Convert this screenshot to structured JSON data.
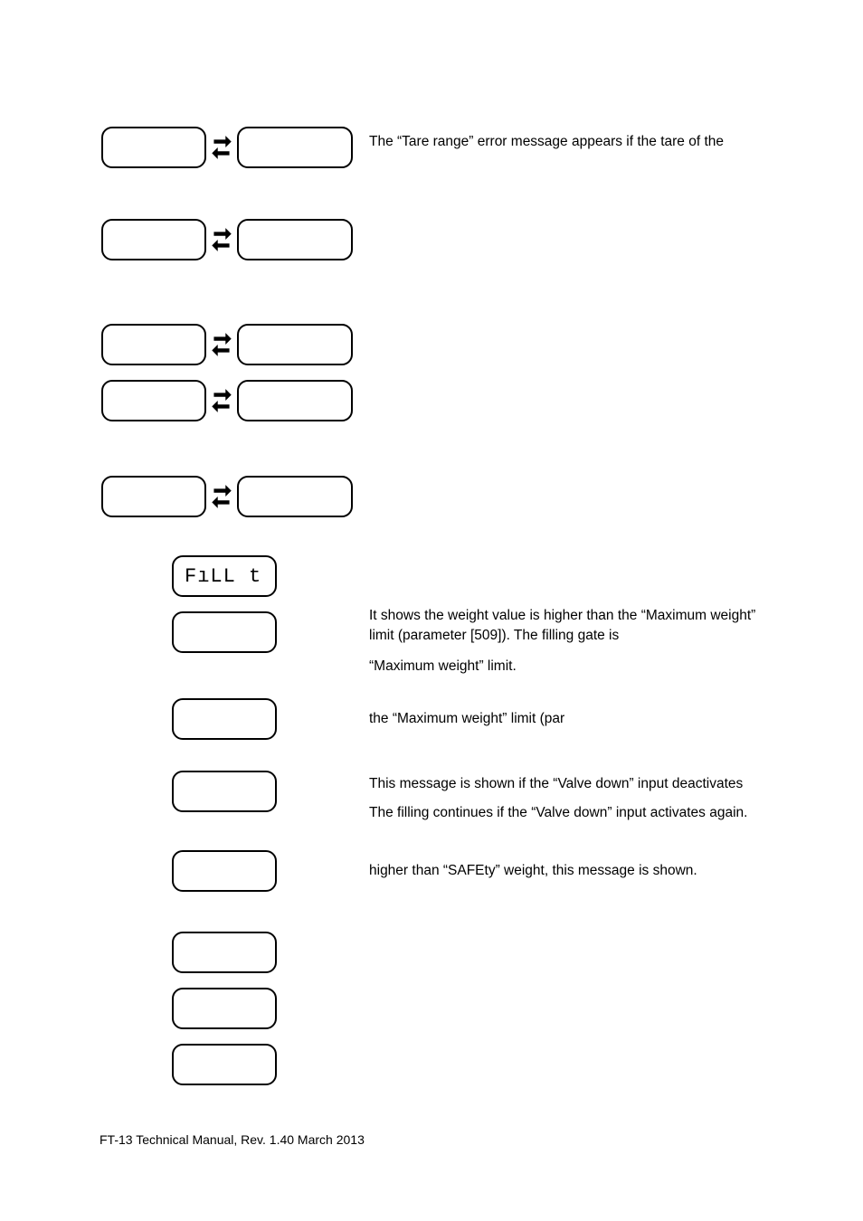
{
  "rows": {
    "r1": {
      "left": "",
      "right": "",
      "text": "The “Tare range” error message appears if the tare of the"
    },
    "r2": {
      "left": "",
      "right": "",
      "text": ""
    },
    "r3": {
      "left": "",
      "right": "",
      "text": ""
    },
    "r4": {
      "left": "",
      "right": "",
      "text": ""
    },
    "r5": {
      "left": "",
      "right": "",
      "text": ""
    }
  },
  "singles": {
    "s1": {
      "label": "FıLL   t",
      "text": ""
    },
    "s2": {
      "label": "",
      "text1": "It shows the weight value is higher than the “Maximum weight” limit (parameter [509]). The filling gate is",
      "text2": "“Maximum weight” limit."
    },
    "s3": {
      "label": "",
      "text": "the “Maximum weight” limit (par"
    },
    "s4": {
      "label": "",
      "text1": "This message is shown if the “Valve down” input deactivates",
      "text2": "The filling continues if the “Valve down” input activates again."
    },
    "s5": {
      "label": "",
      "text": "higher than “SAFEty” weight, this message is shown."
    },
    "s6": {
      "label": "",
      "text": ""
    },
    "s7": {
      "label": "",
      "text": ""
    },
    "s8": {
      "label": "",
      "text": ""
    }
  },
  "footer": "FT-13 Technical Manual, Rev. 1.40   March 2013"
}
